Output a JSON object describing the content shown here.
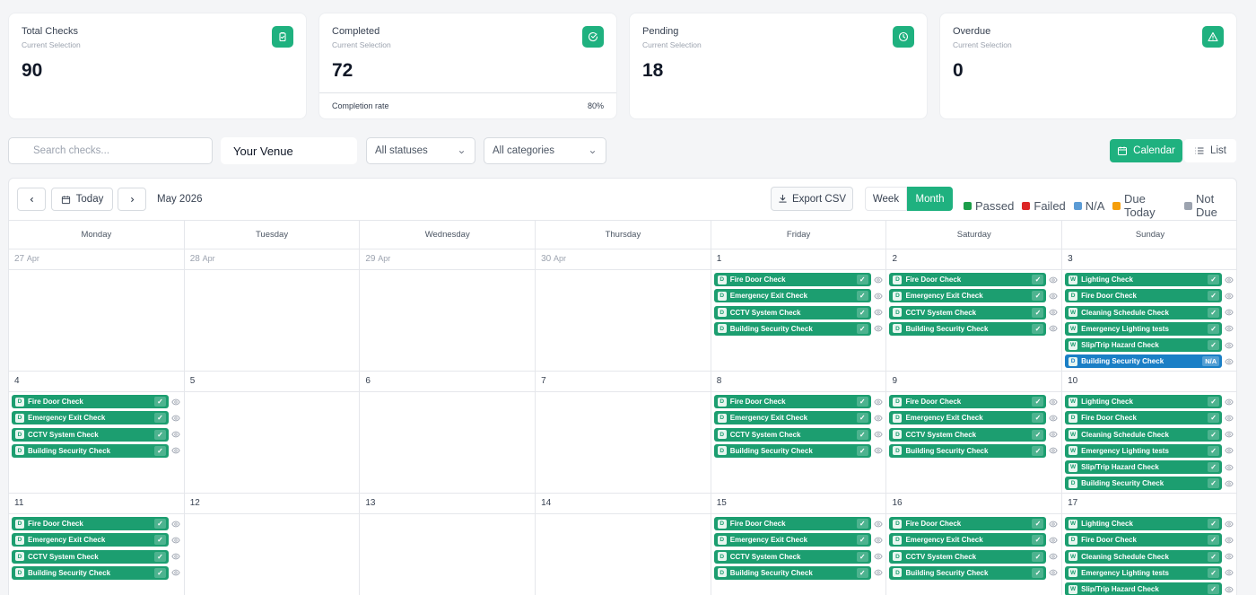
{
  "stats": {
    "total": {
      "title": "Total Checks",
      "sub": "Current Selection",
      "value": "90",
      "icon": "clipboard-check-icon"
    },
    "completed": {
      "title": "Completed",
      "sub": "Current Selection",
      "value": "72",
      "icon": "circle-check-icon",
      "rate_label": "Completion rate",
      "rate_value": "80%"
    },
    "pending": {
      "title": "Pending",
      "sub": "Current Selection",
      "value": "18",
      "icon": "clock-icon"
    },
    "overdue": {
      "title": "Overdue",
      "sub": "Current Selection",
      "value": "0",
      "icon": "warning-icon"
    }
  },
  "filters": {
    "search_placeholder": "Search checks...",
    "venue": "Your Venue",
    "status": "All statuses",
    "category": "All categories"
  },
  "view_toggle": {
    "calendar": "Calendar",
    "list": "List",
    "active": "Calendar"
  },
  "calendar": {
    "today_label": "Today",
    "month_label": "May 2026",
    "export_label": "Export CSV",
    "week_label": "Week",
    "month_view_label": "Month",
    "active_view": "Month",
    "legend": [
      {
        "label": "Passed",
        "color": "#1c9e4a"
      },
      {
        "label": "Failed",
        "color": "#dc2626"
      },
      {
        "label": "N/A",
        "color": "#5b9bd5"
      },
      {
        "label": "Due Today",
        "color": "#f59e0b"
      },
      {
        "label": "Not Due",
        "color": "#9ca3af"
      }
    ],
    "days_of_week": [
      "Monday",
      "Tuesday",
      "Wednesday",
      "Thursday",
      "Friday",
      "Saturday",
      "Sunday"
    ],
    "weeks": [
      [
        {
          "num": "27",
          "mo": "Apr",
          "other": true,
          "tasks": []
        },
        {
          "num": "28",
          "mo": "Apr",
          "other": true,
          "tasks": []
        },
        {
          "num": "29",
          "mo": "Apr",
          "other": true,
          "tasks": []
        },
        {
          "num": "30",
          "mo": "Apr",
          "other": true,
          "tasks": []
        },
        {
          "num": "1",
          "tasks": [
            {
              "f": "D",
              "name": "Fire Door Check",
              "status": "passed"
            },
            {
              "f": "D",
              "name": "Emergency Exit Check",
              "status": "passed"
            },
            {
              "f": "D",
              "name": "CCTV System Check",
              "status": "passed"
            },
            {
              "f": "D",
              "name": "Building Security Check",
              "status": "passed"
            }
          ]
        },
        {
          "num": "2",
          "tasks": [
            {
              "f": "D",
              "name": "Fire Door Check",
              "status": "passed"
            },
            {
              "f": "D",
              "name": "Emergency Exit Check",
              "status": "passed"
            },
            {
              "f": "D",
              "name": "CCTV System Check",
              "status": "passed"
            },
            {
              "f": "D",
              "name": "Building Security Check",
              "status": "passed"
            }
          ]
        },
        {
          "num": "3",
          "tasks": [
            {
              "f": "W",
              "name": "Lighting Check",
              "status": "passed"
            },
            {
              "f": "D",
              "name": "Fire Door Check",
              "status": "passed"
            },
            {
              "f": "W",
              "name": "Cleaning Schedule Check",
              "status": "passed"
            },
            {
              "f": "W",
              "name": "Emergency Lighting tests",
              "status": "passed"
            },
            {
              "f": "W",
              "name": "Slip/Trip Hazard Check",
              "status": "passed"
            },
            {
              "f": "D",
              "name": "Building Security Check",
              "status": "na",
              "status_label": "N/A"
            }
          ]
        }
      ],
      [
        {
          "num": "4",
          "tasks": [
            {
              "f": "D",
              "name": "Fire Door Check",
              "status": "passed"
            },
            {
              "f": "D",
              "name": "Emergency Exit Check",
              "status": "passed"
            },
            {
              "f": "D",
              "name": "CCTV System Check",
              "status": "passed"
            },
            {
              "f": "D",
              "name": "Building Security Check",
              "status": "passed"
            }
          ]
        },
        {
          "num": "5",
          "tasks": []
        },
        {
          "num": "6",
          "tasks": []
        },
        {
          "num": "7",
          "tasks": []
        },
        {
          "num": "8",
          "tasks": [
            {
              "f": "D",
              "name": "Fire Door Check",
              "status": "passed"
            },
            {
              "f": "D",
              "name": "Emergency Exit Check",
              "status": "passed"
            },
            {
              "f": "D",
              "name": "CCTV System Check",
              "status": "passed"
            },
            {
              "f": "D",
              "name": "Building Security Check",
              "status": "passed"
            }
          ]
        },
        {
          "num": "9",
          "tasks": [
            {
              "f": "D",
              "name": "Fire Door Check",
              "status": "passed"
            },
            {
              "f": "D",
              "name": "Emergency Exit Check",
              "status": "passed"
            },
            {
              "f": "D",
              "name": "CCTV System Check",
              "status": "passed"
            },
            {
              "f": "D",
              "name": "Building Security Check",
              "status": "passed"
            }
          ]
        },
        {
          "num": "10",
          "tasks": [
            {
              "f": "W",
              "name": "Lighting Check",
              "status": "passed"
            },
            {
              "f": "D",
              "name": "Fire Door Check",
              "status": "passed"
            },
            {
              "f": "W",
              "name": "Cleaning Schedule Check",
              "status": "passed"
            },
            {
              "f": "W",
              "name": "Emergency Lighting tests",
              "status": "passed"
            },
            {
              "f": "W",
              "name": "Slip/Trip Hazard Check",
              "status": "passed"
            },
            {
              "f": "D",
              "name": "Building Security Check",
              "status": "passed"
            }
          ]
        }
      ],
      [
        {
          "num": "11",
          "tasks": [
            {
              "f": "D",
              "name": "Fire Door Check",
              "status": "passed"
            },
            {
              "f": "D",
              "name": "Emergency Exit Check",
              "status": "passed"
            },
            {
              "f": "D",
              "name": "CCTV System Check",
              "status": "passed"
            },
            {
              "f": "D",
              "name": "Building Security Check",
              "status": "passed"
            }
          ]
        },
        {
          "num": "12",
          "tasks": []
        },
        {
          "num": "13",
          "tasks": []
        },
        {
          "num": "14",
          "tasks": []
        },
        {
          "num": "15",
          "tasks": [
            {
              "f": "D",
              "name": "Fire Door Check",
              "status": "passed"
            },
            {
              "f": "D",
              "name": "Emergency Exit Check",
              "status": "passed"
            },
            {
              "f": "D",
              "name": "CCTV System Check",
              "status": "passed"
            },
            {
              "f": "D",
              "name": "Building Security Check",
              "status": "passed"
            }
          ]
        },
        {
          "num": "16",
          "tasks": [
            {
              "f": "D",
              "name": "Fire Door Check",
              "status": "passed"
            },
            {
              "f": "D",
              "name": "Emergency Exit Check",
              "status": "passed"
            },
            {
              "f": "D",
              "name": "CCTV System Check",
              "status": "passed"
            },
            {
              "f": "D",
              "name": "Building Security Check",
              "status": "passed"
            }
          ]
        },
        {
          "num": "17",
          "tasks": [
            {
              "f": "W",
              "name": "Lighting Check",
              "status": "passed"
            },
            {
              "f": "D",
              "name": "Fire Door Check",
              "status": "passed"
            },
            {
              "f": "W",
              "name": "Cleaning Schedule Check",
              "status": "passed"
            },
            {
              "f": "W",
              "name": "Emergency Lighting tests",
              "status": "passed"
            },
            {
              "f": "W",
              "name": "Slip/Trip Hazard Check",
              "status": "passed"
            }
          ]
        }
      ]
    ]
  }
}
